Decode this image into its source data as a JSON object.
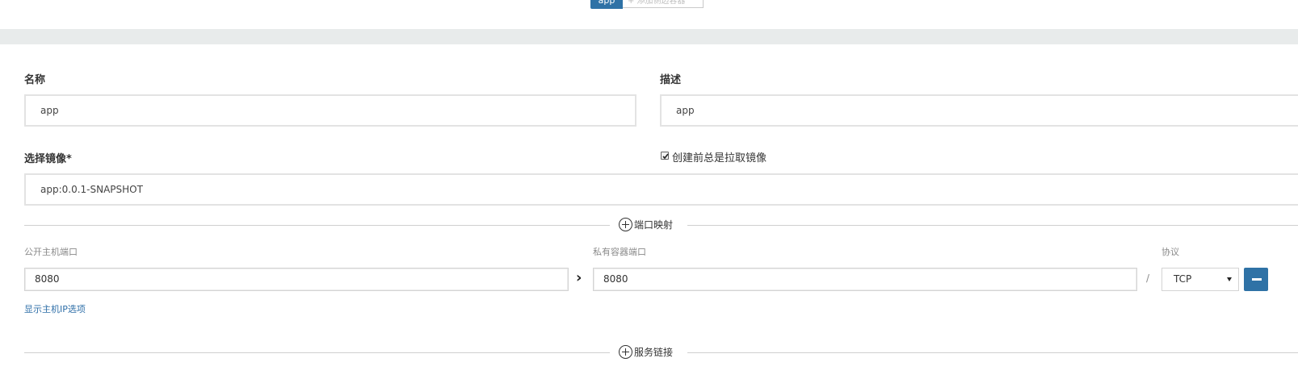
{
  "tabs": {
    "active_label": "app",
    "inactive_label": "+ 添加侧边容器"
  },
  "form": {
    "name_label": "名称",
    "name_value": "app",
    "description_label": "描述",
    "description_value": "app",
    "image_label": "选择镜像*",
    "image_value": "app:0.0.1-SNAPSHOT",
    "pull_image_checkbox": {
      "label": "创建前总是拉取镜像",
      "checked": true
    }
  },
  "port_mapping": {
    "section_title": "端口映射",
    "public_port_label": "公开主机端口",
    "public_port_value": "8080",
    "arrow": "›",
    "private_port_label": "私有容器端口",
    "private_port_value": "8080",
    "separator": "/",
    "protocol_label": "协议",
    "protocol_value": "TCP",
    "show_host_ip_link": "显示主机IP选项"
  },
  "service_links": {
    "section_title": "服务链接"
  },
  "colors": {
    "accent": "#2f72a6",
    "link": "#2f6fa8",
    "band": "#e8ebeb"
  }
}
